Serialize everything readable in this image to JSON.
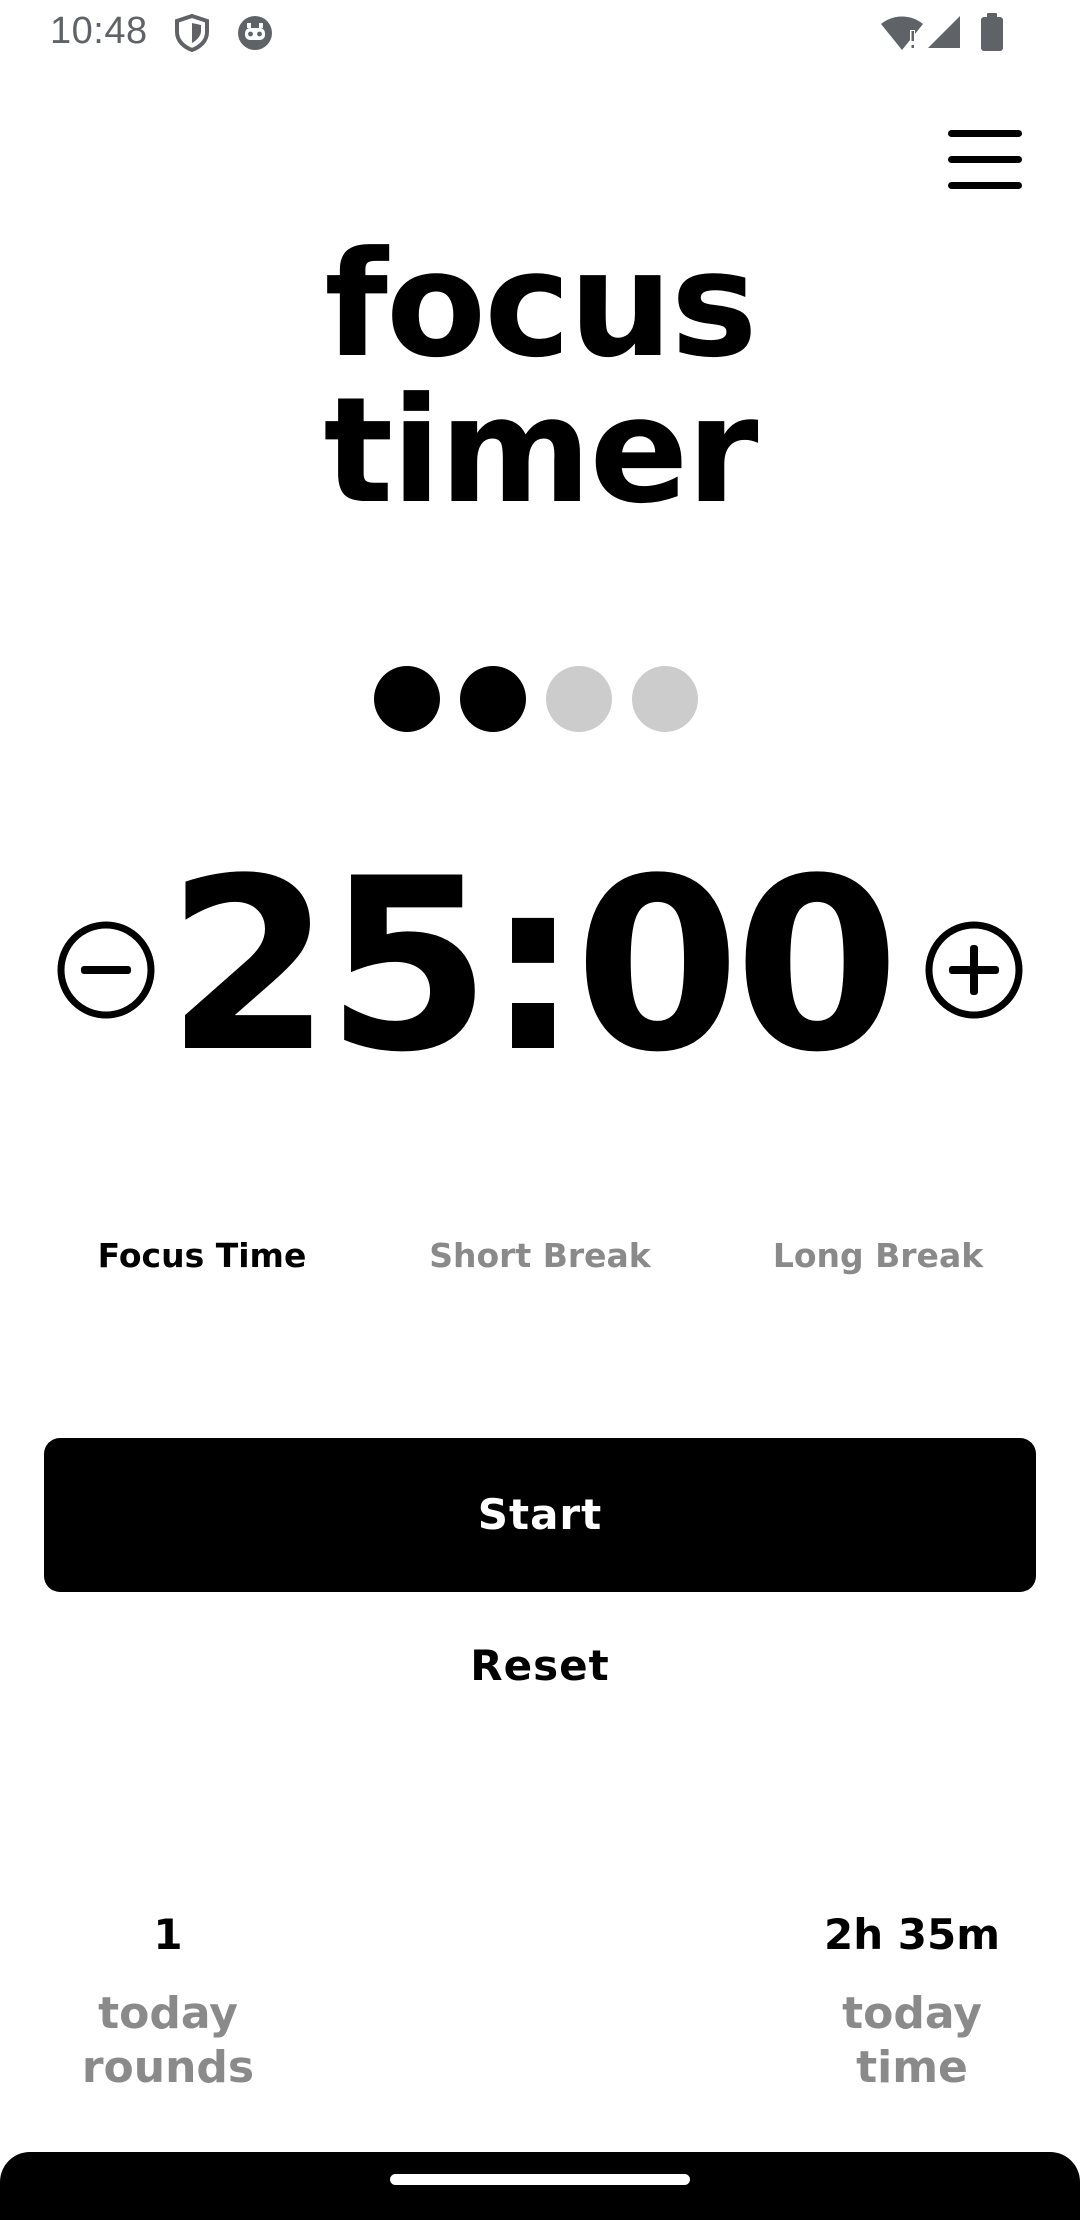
{
  "status_bar": {
    "time": "10:48",
    "icons_left": [
      "shield-icon",
      "robot-icon"
    ],
    "icons_right": [
      "wifi-icon",
      "signal-icon",
      "battery-icon"
    ]
  },
  "menu": {
    "icon": "hamburger-menu-icon"
  },
  "title": {
    "line1": "focus",
    "line2": "timer"
  },
  "rounds": {
    "completed": 2,
    "total": 4,
    "active_color": "#000000",
    "inactive_color": "#cccccc"
  },
  "timer": {
    "display": "25:00",
    "decrease_icon": "minus-circle-icon",
    "increase_icon": "plus-circle-icon"
  },
  "modes": [
    {
      "label": "Focus Time",
      "selected": true
    },
    {
      "label": "Short Break",
      "selected": false
    },
    {
      "label": "Long Break",
      "selected": false
    }
  ],
  "colors": {
    "selected_mode": "#000000",
    "unselected_mode": "#8a8a8a"
  },
  "actions": {
    "start_label": "Start",
    "reset_label": "Reset"
  },
  "stats": {
    "rounds_value": "1",
    "rounds_label_line1": "today",
    "rounds_label_line2": "rounds",
    "time_value": "2h 35m",
    "time_label_line1": "today",
    "time_label_line2": "time"
  }
}
